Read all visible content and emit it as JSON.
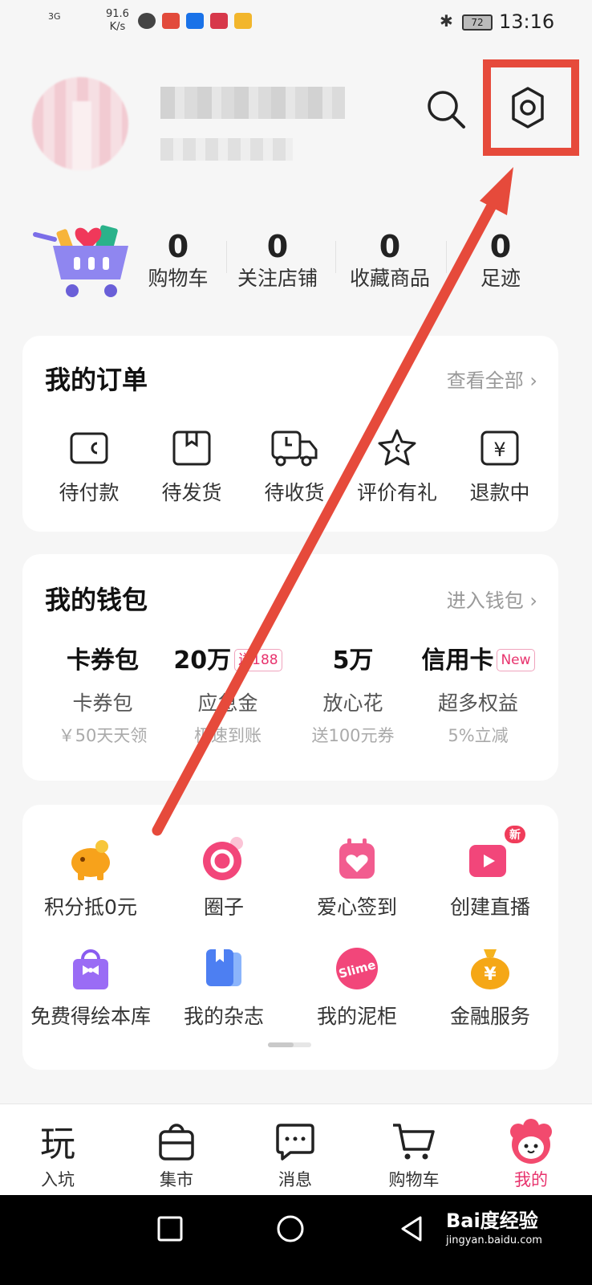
{
  "status_bar": {
    "signal": "3G",
    "speed_value": "91.6",
    "speed_unit": "K/s",
    "battery": "72",
    "time": "13:16"
  },
  "stats": [
    {
      "value": "0",
      "label": "购物车"
    },
    {
      "value": "0",
      "label": "关注店铺"
    },
    {
      "value": "0",
      "label": "收藏商品"
    },
    {
      "value": "0",
      "label": "足迹"
    }
  ],
  "orders": {
    "title": "我的订单",
    "view_all": "查看全部 ›",
    "items": [
      {
        "label": "待付款",
        "icon": "wallet-icon"
      },
      {
        "label": "待发货",
        "icon": "box-icon"
      },
      {
        "label": "待收货",
        "icon": "truck-icon"
      },
      {
        "label": "评价有礼",
        "icon": "star-chat-icon"
      },
      {
        "label": "退款中",
        "icon": "refund-icon"
      }
    ]
  },
  "wallet": {
    "title": "我的钱包",
    "enter": "进入钱包 ›",
    "items": [
      {
        "top": "卡券包",
        "tag": "",
        "mid": "卡券包",
        "bot": "￥50天天领"
      },
      {
        "top": "20万",
        "tag": "送188",
        "mid": "应急金",
        "bot": "极速到账"
      },
      {
        "top": "5万",
        "tag": "",
        "mid": "放心花",
        "bot": "送100元券"
      },
      {
        "top": "信用卡",
        "tag": "New",
        "mid": "超多权益",
        "bot": "5%立减"
      }
    ]
  },
  "services": [
    {
      "label": "积分抵0元",
      "icon": "piggy-bank-icon"
    },
    {
      "label": "圈子",
      "icon": "circle-icon"
    },
    {
      "label": "爱心签到",
      "icon": "heart-calendar-icon"
    },
    {
      "label": "创建直播",
      "icon": "live-icon",
      "badge": "新"
    },
    {
      "label": "免费得绘本库",
      "icon": "gift-bag-icon"
    },
    {
      "label": "我的杂志",
      "icon": "magazine-icon"
    },
    {
      "label": "我的泥柜",
      "icon": "slime-icon",
      "icon_text": "Slime"
    },
    {
      "label": "金融服务",
      "icon": "money-bag-icon"
    }
  ],
  "tabs": [
    {
      "label": "入坑",
      "icon": "play-icon",
      "icon_text": "玩"
    },
    {
      "label": "集市",
      "icon": "shopping-bag-icon"
    },
    {
      "label": "消息",
      "icon": "message-icon"
    },
    {
      "label": "购物车",
      "icon": "cart-icon"
    },
    {
      "label": "我的",
      "icon": "mascot-icon"
    }
  ],
  "watermark": {
    "text": "Bai度经验",
    "sub": "jingyan.baidu.com"
  },
  "colors": {
    "accent": "#e8336d",
    "highlight": "#e64a3b"
  }
}
